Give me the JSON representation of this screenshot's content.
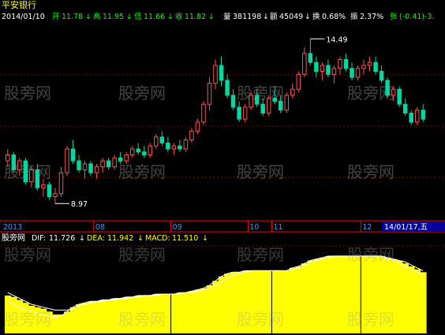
{
  "header": {
    "stock_name": "平安银行",
    "date": "2014/01/10",
    "open_label": "开",
    "open_value": "11.78",
    "high_label": "高",
    "high_value": "11.95",
    "low_label": "低",
    "low_value": "11.66",
    "close_label": "收",
    "close_value": "11.82",
    "volume_label": "量",
    "volume_value": "381198",
    "amount_label": "额",
    "amount_value": "45049",
    "turnover_label": "换",
    "turnover_value": "0.68%",
    "amplitude_label": "振",
    "amplitude_value": "2.37%",
    "change_label": "张",
    "change_value": "(-0.41)-3.",
    "down_arrow": "↓"
  },
  "watermark": "股旁网",
  "colors": {
    "background": "#000000",
    "up_candle": "#ff5050",
    "down_candle": "#00d8a0",
    "macd_bar": "#ffff00",
    "grid": "#8b0000",
    "divider": "#ff0000",
    "axis_text": "#3399ff",
    "header_white": "#ffffff",
    "header_green": "#00ff00",
    "header_red": "#ff4040",
    "header_yellow": "#ffff00",
    "dif_line": "#ffffff",
    "dea_line": "#ffff00",
    "cursor_date_bg": "#0000a0"
  },
  "time_axis": {
    "labels": [
      "2013",
      "08",
      "09",
      "10",
      "11",
      "12"
    ],
    "cursor_date": "14/01/17,五"
  },
  "chart_data": [
    {
      "type": "candlestick",
      "title": "平安银行",
      "annotations": [
        {
          "label": "14.49",
          "value": 14.49,
          "kind": "high"
        },
        {
          "label": "8.97",
          "value": 8.97,
          "kind": "low"
        }
      ],
      "ylim": [
        8.5,
        15.0
      ],
      "x_tick_labels": [
        "2013",
        "08",
        "09",
        "10",
        "11",
        "12"
      ],
      "ohlc": [
        [
          10.4,
          10.8,
          10.2,
          10.6
        ],
        [
          10.6,
          10.7,
          10.0,
          10.1
        ],
        [
          10.1,
          10.5,
          9.9,
          10.4
        ],
        [
          10.4,
          10.5,
          9.6,
          9.7
        ],
        [
          9.7,
          10.2,
          9.5,
          10.1
        ],
        [
          10.1,
          10.3,
          9.4,
          9.5
        ],
        [
          9.5,
          9.8,
          9.2,
          9.6
        ],
        [
          9.6,
          9.7,
          9.1,
          9.2
        ],
        [
          9.2,
          9.5,
          8.97,
          9.3
        ],
        [
          9.3,
          10.2,
          9.2,
          10.0
        ],
        [
          10.0,
          10.9,
          9.9,
          10.8
        ],
        [
          10.8,
          11.1,
          10.3,
          10.4
        ],
        [
          10.4,
          10.6,
          10.0,
          10.1
        ],
        [
          10.1,
          10.4,
          9.8,
          10.3
        ],
        [
          10.3,
          10.4,
          9.9,
          10.0
        ],
        [
          10.0,
          10.3,
          9.8,
          10.2
        ],
        [
          10.2,
          10.5,
          10.0,
          10.4
        ],
        [
          10.4,
          10.5,
          10.1,
          10.2
        ],
        [
          10.2,
          10.6,
          10.1,
          10.5
        ],
        [
          10.5,
          10.7,
          10.3,
          10.4
        ],
        [
          10.4,
          10.7,
          10.3,
          10.6
        ],
        [
          10.6,
          10.9,
          10.5,
          10.8
        ],
        [
          10.8,
          11.0,
          10.6,
          10.7
        ],
        [
          10.7,
          10.9,
          10.5,
          10.6
        ],
        [
          10.6,
          11.0,
          10.5,
          10.9
        ],
        [
          10.9,
          11.3,
          10.8,
          11.2
        ],
        [
          11.2,
          11.4,
          10.9,
          11.0
        ],
        [
          11.0,
          11.2,
          10.7,
          10.8
        ],
        [
          10.8,
          11.0,
          10.6,
          10.9
        ],
        [
          10.9,
          11.1,
          10.7,
          10.8
        ],
        [
          10.8,
          11.2,
          10.7,
          11.1
        ],
        [
          11.1,
          11.5,
          11.0,
          11.4
        ],
        [
          11.4,
          11.8,
          11.3,
          11.7
        ],
        [
          11.7,
          12.4,
          11.6,
          12.3
        ],
        [
          12.3,
          13.2,
          12.1,
          13.0
        ],
        [
          13.0,
          13.8,
          12.8,
          13.6
        ],
        [
          13.6,
          13.9,
          12.9,
          13.1
        ],
        [
          13.1,
          13.3,
          12.5,
          12.6
        ],
        [
          12.6,
          12.8,
          12.1,
          12.2
        ],
        [
          12.2,
          12.4,
          11.7,
          11.8
        ],
        [
          11.8,
          12.3,
          11.7,
          12.2
        ],
        [
          12.2,
          12.7,
          12.1,
          12.6
        ],
        [
          12.6,
          12.8,
          12.2,
          12.3
        ],
        [
          12.3,
          12.5,
          11.9,
          12.0
        ],
        [
          12.0,
          12.6,
          11.9,
          12.5
        ],
        [
          12.5,
          12.9,
          12.3,
          12.4
        ],
        [
          12.4,
          12.6,
          12.0,
          12.1
        ],
        [
          12.1,
          12.7,
          12.0,
          12.6
        ],
        [
          12.6,
          13.0,
          12.5,
          12.8
        ],
        [
          12.8,
          13.4,
          12.7,
          13.3
        ],
        [
          13.3,
          14.2,
          13.2,
          14.0
        ],
        [
          14.0,
          14.49,
          13.6,
          13.7
        ],
        [
          13.7,
          13.9,
          13.2,
          13.4
        ],
        [
          13.4,
          13.7,
          13.1,
          13.6
        ],
        [
          13.6,
          13.8,
          13.2,
          13.3
        ],
        [
          13.3,
          13.6,
          13.0,
          13.5
        ],
        [
          13.5,
          13.9,
          13.3,
          13.8
        ],
        [
          13.8,
          14.0,
          13.4,
          13.5
        ],
        [
          13.5,
          13.7,
          13.1,
          13.2
        ],
        [
          13.2,
          13.6,
          13.1,
          13.5
        ],
        [
          13.5,
          13.8,
          13.3,
          13.6
        ],
        [
          13.6,
          13.9,
          13.4,
          13.7
        ],
        [
          13.7,
          13.9,
          13.3,
          13.4
        ],
        [
          13.4,
          13.6,
          13.0,
          13.1
        ],
        [
          13.1,
          13.2,
          12.5,
          12.6
        ],
        [
          12.6,
          12.9,
          12.4,
          12.8
        ],
        [
          12.8,
          12.9,
          12.2,
          12.3
        ],
        [
          12.3,
          12.5,
          11.9,
          12.0
        ],
        [
          12.0,
          12.1,
          11.6,
          11.7
        ],
        [
          11.7,
          12.2,
          11.6,
          12.1
        ],
        [
          12.1,
          12.3,
          11.7,
          11.8
        ]
      ]
    },
    {
      "type": "bar",
      "title": "MACD",
      "indicator_name": "股旁网",
      "legend": [
        {
          "label": "DIF:",
          "value": "11.726"
        },
        {
          "label": "DEA:",
          "value": "11.942"
        },
        {
          "label": "MACD:",
          "value": "11.510"
        }
      ],
      "values": [
        10.6,
        10.5,
        10.3,
        10.1,
        9.9,
        9.8,
        9.7,
        9.5,
        9.3,
        9.3,
        9.5,
        9.8,
        10.0,
        10.1,
        10.2,
        10.2,
        10.3,
        10.3,
        10.4,
        10.4,
        10.5,
        10.5,
        10.6,
        10.6,
        10.6,
        10.7,
        10.7,
        10.7,
        10.7,
        10.8,
        10.8,
        10.9,
        11.0,
        11.1,
        11.3,
        11.6,
        11.9,
        12.1,
        12.2,
        12.2,
        12.3,
        12.3,
        12.3,
        12.3,
        12.3,
        12.3,
        12.3,
        12.3,
        12.5,
        12.6,
        12.8,
        13.0,
        13.1,
        13.2,
        13.3,
        13.3,
        13.3,
        13.3,
        13.3,
        13.3,
        13.3,
        13.3,
        13.3,
        13.3,
        13.2,
        13.1,
        13.0,
        12.8,
        12.6,
        12.4,
        12.2
      ],
      "dif": [
        10.2,
        10.0,
        9.8,
        9.6,
        9.5,
        9.4,
        9.3,
        9.2,
        9.1,
        9.2,
        9.5,
        9.8,
        10.0,
        10.1,
        10.2,
        10.2,
        10.3,
        10.3,
        10.4,
        10.4,
        10.5,
        10.5,
        10.6,
        10.6,
        10.6,
        10.7,
        10.7,
        10.7,
        10.7,
        10.8,
        10.8,
        10.9,
        11.0,
        11.1,
        11.3,
        11.6,
        11.9,
        12.1,
        12.2,
        12.2,
        12.3,
        12.3,
        12.3,
        12.3,
        12.3,
        12.3,
        12.3,
        12.3,
        12.5,
        12.6,
        12.8,
        13.0,
        13.1,
        13.2,
        13.3,
        13.3,
        13.3,
        13.3,
        13.3,
        13.3,
        13.3,
        13.3,
        13.3,
        13.3,
        13.1,
        13.0,
        12.8,
        12.6,
        12.4,
        12.2,
        12.0
      ],
      "dea": [
        10.8,
        10.6,
        10.4,
        10.2,
        10.0,
        9.9,
        9.8,
        9.7,
        9.6,
        9.6,
        9.6,
        9.7,
        9.9,
        10.0,
        10.1,
        10.2,
        10.2,
        10.3,
        10.3,
        10.4,
        10.4,
        10.5,
        10.5,
        10.6,
        10.6,
        10.6,
        10.7,
        10.7,
        10.7,
        10.7,
        10.8,
        10.8,
        10.9,
        11.0,
        11.1,
        11.3,
        11.5,
        11.8,
        12.0,
        12.1,
        12.2,
        12.3,
        12.3,
        12.3,
        12.3,
        12.3,
        12.3,
        12.3,
        12.4,
        12.5,
        12.7,
        12.9,
        13.0,
        13.1,
        13.2,
        13.3,
        13.3,
        13.3,
        13.3,
        13.3,
        13.3,
        13.3,
        13.3,
        13.3,
        13.2,
        13.1,
        13.0,
        12.9,
        12.7,
        12.5,
        12.3
      ],
      "ylim": [
        8.0,
        14.0
      ]
    }
  ]
}
